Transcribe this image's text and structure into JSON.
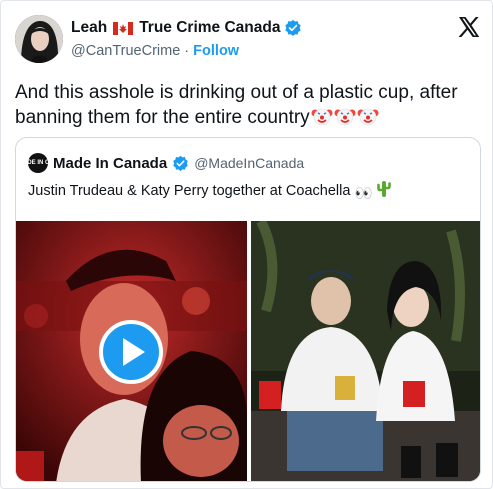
{
  "author": {
    "name": "Leah",
    "name_suffix": "True Crime Canada",
    "handle": "@CanTrueCrime",
    "separator": "·",
    "follow_label": "Follow"
  },
  "tweet": {
    "text": "And this asshole is drinking out of a plastic cup, after banning them for the entire country",
    "emoji": [
      "clown-face",
      "clown-face",
      "clown-face"
    ]
  },
  "quoted": {
    "avatar_text": "MADE IN CAN",
    "name": "Made In Canada",
    "handle": "@MadeInCanada",
    "text": "Justin Trudeau & Katy Perry together at Coachella",
    "text_emoji": "👀"
  },
  "colors": {
    "accent": "#1d9bf0",
    "text": "#0f1419",
    "secondary": "#536471",
    "flag_red": "#d52b1e"
  },
  "icons": {
    "platform": "x-logo",
    "verified": "verified-badge-icon",
    "play": "play-icon",
    "cactus": "cactus-icon"
  }
}
